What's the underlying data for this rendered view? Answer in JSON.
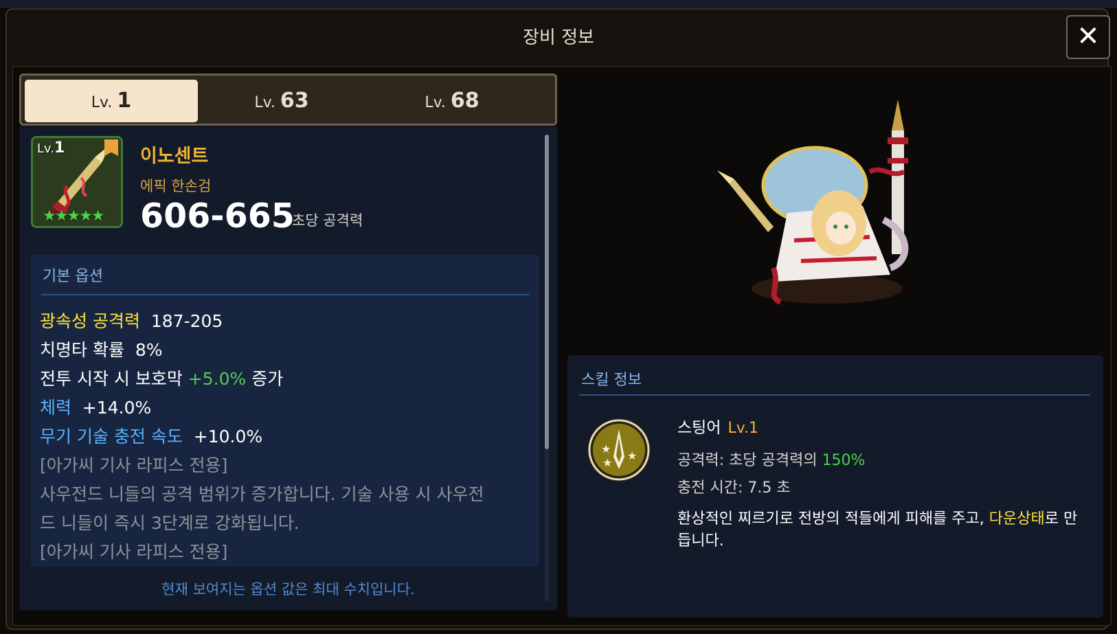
{
  "window": {
    "title": "장비 정보",
    "close_label": "✕"
  },
  "tabs": [
    {
      "prefix": "Lv.",
      "num": "1",
      "active": true
    },
    {
      "prefix": "Lv.",
      "num": "63",
      "active": false
    },
    {
      "prefix": "Lv.",
      "num": "68",
      "active": false
    }
  ],
  "item": {
    "icon_level_prefix": "Lv.",
    "icon_level": "1",
    "stars": "★★★★★",
    "name": "이노센트",
    "type": "에픽 한손검",
    "dps": "606-665",
    "dps_label": "초당 공격력"
  },
  "options": {
    "title": "기본 옵션",
    "lines": [
      {
        "label": "광속성 공격력",
        "value": "187-205"
      },
      {
        "label": "치명타 확률",
        "value": "8%"
      },
      {
        "prefix": "전투 시작 시 보호막",
        "value": "+5.0%",
        "suffix": "증가"
      },
      {
        "label": "체력",
        "value": "+14.0%"
      },
      {
        "label": "무기 기술 충전 속도",
        "value": "+10.0%"
      }
    ],
    "exclusive_1": "[아가씨 기사 라피스 전용]",
    "exclusive_desc_1": "사우전드 니들의 공격 범위가 증가합니다. 기술 사용 시 사우전",
    "exclusive_desc_2": "드 니들이 즉시 3단계로 강화됩니다.",
    "exclusive_2": "[아가씨 기사 라피스 전용]",
    "footer_note": "현재 보여지는 옵션 값은 최대 수치입니다."
  },
  "skill": {
    "title": "스킬 정보",
    "name": "스팅어",
    "level": "Lv.1",
    "attack_label": "공격력: 초당 공격력의",
    "attack_value": "150%",
    "charge_time": "충전 시간: 7.5 초",
    "desc_part1": "환상적인 찌르기로 전방의 적들에게 피해를 주고,",
    "desc_highlight": "다운상태",
    "desc_part2": "로 만듭니다."
  },
  "colors": {
    "accent_gold": "#f2b431",
    "stat_yellow": "#ffe23a",
    "stat_green": "#4fd14a",
    "stat_blue": "#58b2ff",
    "panel_blue": "#131a2a",
    "tab_active": "#f7e4cc"
  },
  "icons": [
    "close-icon",
    "weapon-icon",
    "star-icon",
    "skill-stinger-icon",
    "character-portrait"
  ]
}
